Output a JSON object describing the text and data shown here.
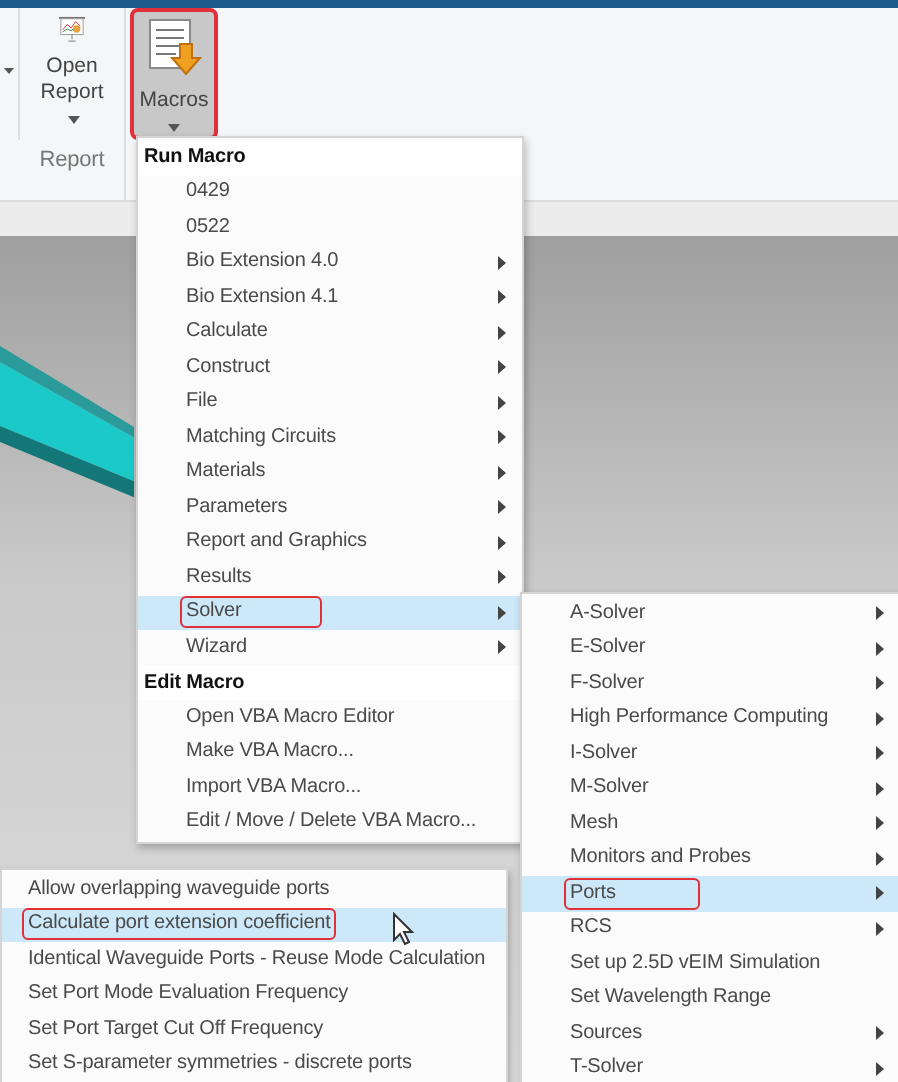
{
  "ribbon": {
    "buttons": [
      {
        "kind": "large",
        "label": "Open",
        "label_line2": "Report"
      },
      {
        "kind": "large",
        "label": "Macros",
        "pressed": true,
        "highlighted": true
      }
    ],
    "group_label": "Report"
  },
  "macro_menu": {
    "items": [
      {
        "kind": "header",
        "label": "Run Macro"
      },
      {
        "kind": "item",
        "label": "0429",
        "submenu": false,
        "selected": false,
        "highlighted": false
      },
      {
        "kind": "item",
        "label": "0522",
        "submenu": false,
        "selected": false,
        "highlighted": false
      },
      {
        "kind": "item",
        "label": "Bio Extension 4.0",
        "submenu": true,
        "selected": false,
        "highlighted": false
      },
      {
        "kind": "item",
        "label": "Bio Extension 4.1",
        "submenu": true,
        "selected": false,
        "highlighted": false
      },
      {
        "kind": "item",
        "label": "Calculate",
        "submenu": true,
        "selected": false,
        "highlighted": false
      },
      {
        "kind": "item",
        "label": "Construct",
        "submenu": true,
        "selected": false,
        "highlighted": false
      },
      {
        "kind": "item",
        "label": "File",
        "submenu": true,
        "selected": false,
        "highlighted": false
      },
      {
        "kind": "item",
        "label": "Matching Circuits",
        "submenu": true,
        "selected": false,
        "highlighted": false
      },
      {
        "kind": "item",
        "label": "Materials",
        "submenu": true,
        "selected": false,
        "highlighted": false
      },
      {
        "kind": "item",
        "label": "Parameters",
        "submenu": true,
        "selected": false,
        "highlighted": false
      },
      {
        "kind": "item",
        "label": "Report and Graphics",
        "submenu": true,
        "selected": false,
        "highlighted": false
      },
      {
        "kind": "item",
        "label": "Results",
        "submenu": true,
        "selected": false,
        "highlighted": false
      },
      {
        "kind": "item",
        "label": "Solver",
        "submenu": true,
        "selected": true,
        "highlighted": true
      },
      {
        "kind": "item",
        "label": "Wizard",
        "submenu": true,
        "selected": false,
        "highlighted": false
      },
      {
        "kind": "header",
        "label": "Edit Macro"
      },
      {
        "kind": "item",
        "label": "Open VBA Macro Editor",
        "submenu": false,
        "selected": false,
        "highlighted": false
      },
      {
        "kind": "item",
        "label": "Make VBA Macro...",
        "submenu": false,
        "selected": false,
        "highlighted": false
      },
      {
        "kind": "item",
        "label": "Import VBA Macro...",
        "submenu": false,
        "selected": false,
        "highlighted": false
      },
      {
        "kind": "item",
        "label": "Edit / Move / Delete VBA Macro...",
        "submenu": false,
        "selected": false,
        "highlighted": false
      }
    ]
  },
  "solver_menu": {
    "items": [
      {
        "kind": "item",
        "label": "A-Solver",
        "submenu": true,
        "selected": false,
        "highlighted": false
      },
      {
        "kind": "item",
        "label": "E-Solver",
        "submenu": true,
        "selected": false,
        "highlighted": false
      },
      {
        "kind": "item",
        "label": "F-Solver",
        "submenu": true,
        "selected": false,
        "highlighted": false
      },
      {
        "kind": "item",
        "label": "High Performance Computing",
        "submenu": true,
        "selected": false,
        "highlighted": false
      },
      {
        "kind": "item",
        "label": "I-Solver",
        "submenu": true,
        "selected": false,
        "highlighted": false
      },
      {
        "kind": "item",
        "label": "M-Solver",
        "submenu": true,
        "selected": false,
        "highlighted": false
      },
      {
        "kind": "item",
        "label": "Mesh",
        "submenu": true,
        "selected": false,
        "highlighted": false
      },
      {
        "kind": "item",
        "label": "Monitors and Probes",
        "submenu": true,
        "selected": false,
        "highlighted": false
      },
      {
        "kind": "item",
        "label": "Ports",
        "submenu": true,
        "selected": true,
        "highlighted": true
      },
      {
        "kind": "item",
        "label": "RCS",
        "submenu": true,
        "selected": false,
        "highlighted": false
      },
      {
        "kind": "item",
        "label": "Set up 2.5D vEIM Simulation",
        "submenu": false,
        "selected": false,
        "highlighted": false
      },
      {
        "kind": "item",
        "label": "Set Wavelength Range",
        "submenu": false,
        "selected": false,
        "highlighted": false
      },
      {
        "kind": "item",
        "label": "Sources",
        "submenu": true,
        "selected": false,
        "highlighted": false
      },
      {
        "kind": "item",
        "label": "T-Solver",
        "submenu": true,
        "selected": false,
        "highlighted": false
      }
    ]
  },
  "ports_menu": {
    "items": [
      {
        "kind": "item",
        "label": "Allow overlapping waveguide ports",
        "selected": false,
        "highlighted": false
      },
      {
        "kind": "item",
        "label": "Calculate port extension coefficient",
        "selected": true,
        "highlighted": true
      },
      {
        "kind": "item",
        "label": "Identical Waveguide Ports - Reuse Mode Calculation",
        "selected": false,
        "highlighted": false
      },
      {
        "kind": "item",
        "label": "Set Port Mode Evaluation Frequency",
        "selected": false,
        "highlighted": false
      },
      {
        "kind": "item",
        "label": "Set Port Target Cut Off Frequency",
        "selected": false,
        "highlighted": false
      },
      {
        "kind": "item",
        "label": "Set S-parameter symmetries - discrete ports",
        "selected": false,
        "highlighted": false
      }
    ]
  }
}
